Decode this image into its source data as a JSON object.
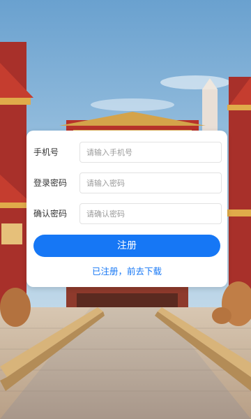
{
  "background": {
    "scene": "palace-courtyard-background",
    "sky_color": "#87b5d8",
    "roof_color": "#c0392b",
    "accent_gold": "#e8b04a"
  },
  "form": {
    "phone": {
      "label": "手机号",
      "placeholder": "请输入手机号",
      "value": ""
    },
    "password": {
      "label": "登录密码",
      "placeholder": "请输入密码",
      "value": ""
    },
    "confirm": {
      "label": "确认密码",
      "placeholder": "请确认密码",
      "value": ""
    },
    "submit_label": "注册",
    "login_link_text": "已注册，前去下载"
  },
  "colors": {
    "primary": "#1677f5",
    "card": "#ffffff",
    "label_text": "#333333",
    "placeholder_text": "#9a9a9a"
  }
}
